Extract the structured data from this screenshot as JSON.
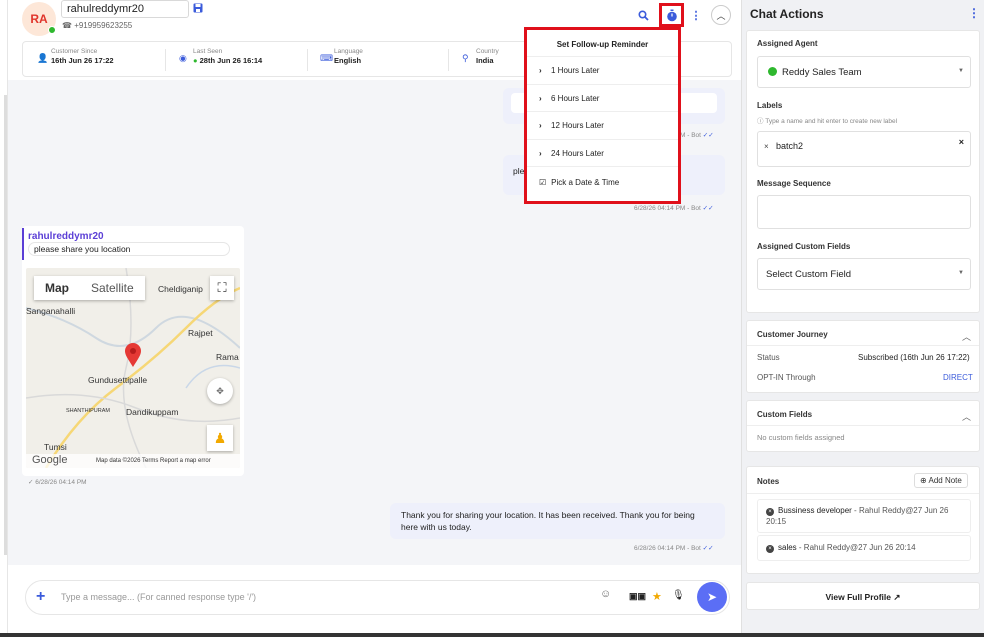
{
  "header": {
    "avatar_initials": "RA",
    "name_value": "rahulreddymr20",
    "phone": "+919959623255"
  },
  "info_bar": [
    {
      "label": "Customer Since",
      "value": "16th Jun 26 17:22",
      "icon": "user-icon"
    },
    {
      "label": "Last Seen",
      "value": "28th Jun 26 16:14",
      "icon": "eye-icon"
    },
    {
      "label": "Language",
      "value": "English",
      "icon": "language-icon"
    },
    {
      "label": "Country",
      "value": "India",
      "icon": "location-pin-icon"
    }
  ],
  "chat": {
    "meta1": "M - Bot",
    "partial_text": "ple",
    "meta2": "6/28/26 04:14 PM - Bot",
    "location_sender": "rahulreddymr20",
    "location_text": "please share you location",
    "map": {
      "toggle_map": "Map",
      "toggle_satellite": "Satellite",
      "labels": [
        "Cheldiganip",
        "Sanganahalli",
        "Rajpet",
        "Rama",
        "Gundusettipalle",
        "SHANTHIPURAM",
        "Dandikuppam",
        "Tumsi"
      ],
      "footer": "Map data ©2026  Terms  Report a map error",
      "google": "Google"
    },
    "location_meta": "6/28/26 04:14 PM",
    "reply_text": "Thank you for sharing your location. It has been received. Thank you for being here with us today.",
    "reply_meta": "6/28/26 04:14 PM - Bot"
  },
  "compose": {
    "placeholder": "Type a message... (For canned response type '/')"
  },
  "followup": {
    "title": "Set Follow-up Reminder",
    "options": [
      "1 Hours Later",
      "6 Hours Later",
      "12 Hours Later",
      "24 Hours Later"
    ],
    "pick": "Pick a Date & Time"
  },
  "panel": {
    "title": "Chat Actions",
    "assigned_agent_label": "Assigned Agent",
    "assigned_agent_value": "Reddy Sales Team",
    "labels_label": "Labels",
    "labels_hint": "Type a name and hit enter to create new label",
    "label_tag": "batch2",
    "message_sequence_label": "Message Sequence",
    "custom_fields_label": "Assigned Custom Fields",
    "custom_fields_value": "Select Custom Field",
    "journey_title": "Customer Journey",
    "status_label": "Status",
    "status_value": "Subscribed (16th Jun 26 17:22)",
    "optin_label": "OPT-IN Through",
    "optin_value": "DIRECT",
    "custom_fields_title": "Custom Fields",
    "custom_fields_empty": "No custom fields assigned",
    "notes_title": "Notes",
    "add_note": "Add Note",
    "notes": [
      {
        "text": "Bussiness developer",
        "meta": " - Rahul Reddy@27 Jun 26 20:15"
      },
      {
        "text": "sales",
        "meta": " - Rahul Reddy@27 Jun 26 20:14"
      }
    ],
    "view_profile": "View Full Profile"
  },
  "colors": {
    "accent": "#3b5bdb",
    "highlight": "#e0101b",
    "purple": "#5b3fd6"
  }
}
